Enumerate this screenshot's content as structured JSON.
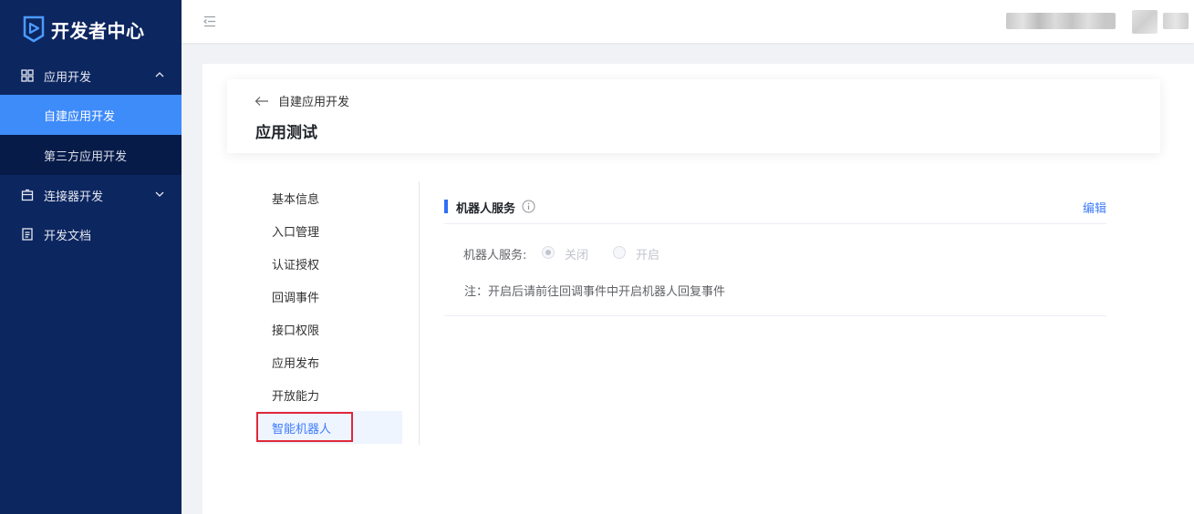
{
  "brand": {
    "title": "开发者中心"
  },
  "sidebar": {
    "menus": [
      {
        "label": "应用开发",
        "icon": "grid-icon",
        "expanded": true
      },
      {
        "label": "连接器开发",
        "icon": "package-icon",
        "expanded": false
      },
      {
        "label": "开发文档",
        "icon": "document-icon"
      }
    ],
    "submenu": [
      {
        "label": "自建应用开发",
        "active": true
      },
      {
        "label": "第三方应用开发",
        "active": false
      }
    ]
  },
  "header": {
    "back_label": "自建应用开发",
    "page_title": "应用测试"
  },
  "tabs": [
    {
      "label": "基本信息"
    },
    {
      "label": "入口管理"
    },
    {
      "label": "认证授权"
    },
    {
      "label": "回调事件"
    },
    {
      "label": "接口权限"
    },
    {
      "label": "应用发布"
    },
    {
      "label": "开放能力"
    },
    {
      "label": "智能机器人",
      "active": true
    }
  ],
  "section": {
    "title": "机器人服务",
    "edit_label": "编辑",
    "field_label": "机器人服务:",
    "options": [
      {
        "label": "关闭",
        "checked": true
      },
      {
        "label": "开启",
        "checked": false
      }
    ],
    "note": "注：开启后请前往回调事件中开启机器人回复事件"
  },
  "colors": {
    "sidebar_bg": "#0c2660",
    "active_menu": "#3e8bfa",
    "accent": "#3e7bfa",
    "highlight_box": "#e0283a"
  }
}
